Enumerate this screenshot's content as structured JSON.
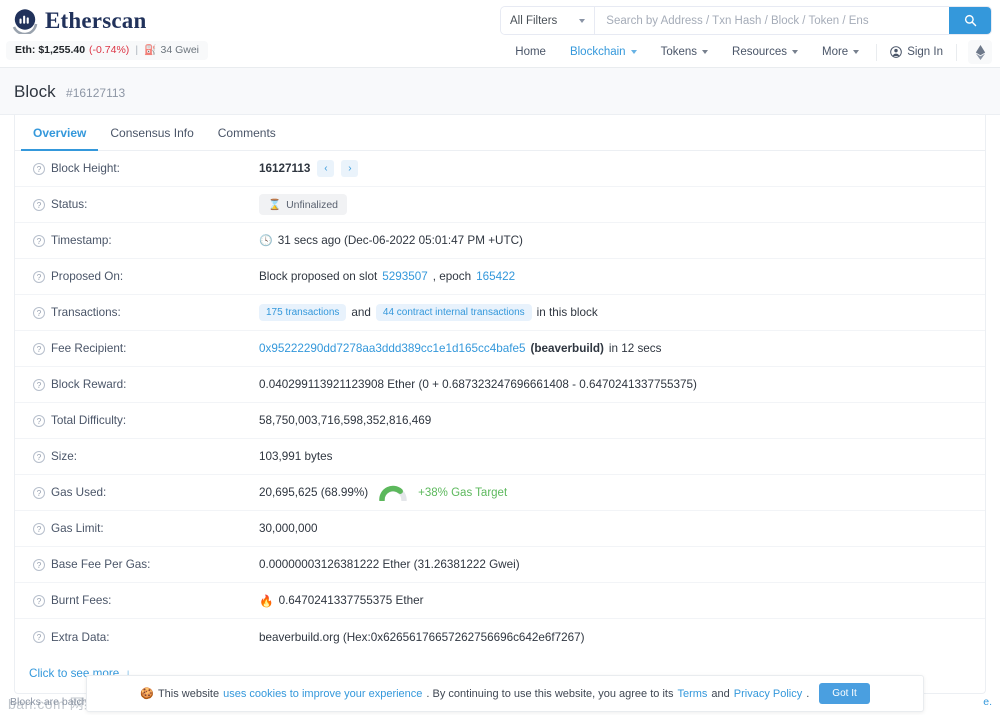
{
  "header": {
    "brand": "Etherscan",
    "price": {
      "eth_label": "Eth: $1,255.40",
      "change": "(-0.74%)",
      "separator": "|",
      "gas": "34 Gwei"
    },
    "search": {
      "filter_label": "All Filters",
      "placeholder": "Search by Address / Txn Hash / Block / Token / Ens",
      "value": ""
    },
    "nav": [
      {
        "label": "Home",
        "has_caret": false,
        "active": false
      },
      {
        "label": "Blockchain",
        "has_caret": true,
        "active": true
      },
      {
        "label": "Tokens",
        "has_caret": true,
        "active": false
      },
      {
        "label": "Resources",
        "has_caret": true,
        "active": false
      },
      {
        "label": "More",
        "has_caret": true,
        "active": false
      }
    ],
    "sign_in": "Sign In"
  },
  "page": {
    "title": "Block",
    "subtitle": "#16127113"
  },
  "tabs": [
    {
      "label": "Overview",
      "active": true
    },
    {
      "label": "Consensus Info",
      "active": false
    },
    {
      "label": "Comments",
      "active": false
    }
  ],
  "rows": {
    "block_height": {
      "label": "Block Height:",
      "value": "16127113",
      "prev": "‹",
      "next": "›"
    },
    "status": {
      "label": "Status:",
      "badge": "Unfinalized",
      "badge_icon": "⌛"
    },
    "timestamp": {
      "label": "Timestamp:",
      "icon": "◷",
      "value": "31 secs ago (Dec-06-2022 05:01:47 PM +UTC)"
    },
    "proposed_on": {
      "label": "Proposed On:",
      "prefix": "Block proposed on slot",
      "slot": "5293507",
      "mid": ", epoch",
      "epoch": "165422"
    },
    "transactions": {
      "label": "Transactions:",
      "txn_badge": "175 transactions",
      "conj": "and",
      "internal_badge": "44 contract internal transactions",
      "suffix": "in this block"
    },
    "fee_recipient": {
      "label": "Fee Recipient:",
      "address": "0x95222290dd7278aa3ddd389cc1e1d165cc4bafe5",
      "name": "(beaverbuild)",
      "suffix": "in 12 secs"
    },
    "block_reward": {
      "label": "Block Reward:",
      "value": "0.040299113921123908 Ether (0 + 0.687323247696661408 - 0.6470241337755375)"
    },
    "total_difficulty": {
      "label": "Total Difficulty:",
      "value": "58,750,003,716,598,352,816,469"
    },
    "size": {
      "label": "Size:",
      "value": "103,991 bytes"
    },
    "gas_used": {
      "label": "Gas Used:",
      "value": "20,695,625 (68.99%)",
      "gas_target": "+38% Gas Target",
      "gauge_percent": 69
    },
    "gas_limit": {
      "label": "Gas Limit:",
      "value": "30,000,000"
    },
    "base_fee": {
      "label": "Base Fee Per Gas:",
      "value": "0.00000003126381222 Ether (31.26381222 Gwei)"
    },
    "burnt_fees": {
      "label": "Burnt Fees:",
      "icon": "🔥",
      "value": "0.6470241337755375 Ether"
    },
    "extra_data": {
      "label": "Extra Data:",
      "value": "beaverbuild.org (Hex:0x62656176657262756696c642e6f7267)"
    }
  },
  "see_more": {
    "label": "Click to see more",
    "arrow": "↓"
  },
  "footer": {
    "note": "Blocks are batch",
    "right_fragment": "e."
  },
  "watermark": "ban.com 网络图片仅供展示，非存储，如有侵权请联系删除。",
  "cookie": {
    "icon": "🍪",
    "text_1": "This website",
    "link_1": "uses cookies to improve your experience",
    "text_2": ". By continuing to use this website, you agree to its",
    "link_2": "Terms",
    "text_3": "and",
    "link_3": "Privacy Policy",
    "text_4": ".",
    "button": "Got It"
  },
  "colors": {
    "brand_navy": "#21325b",
    "accent_blue": "#3498db",
    "red": "#dc3545",
    "green": "#5cb85c"
  }
}
